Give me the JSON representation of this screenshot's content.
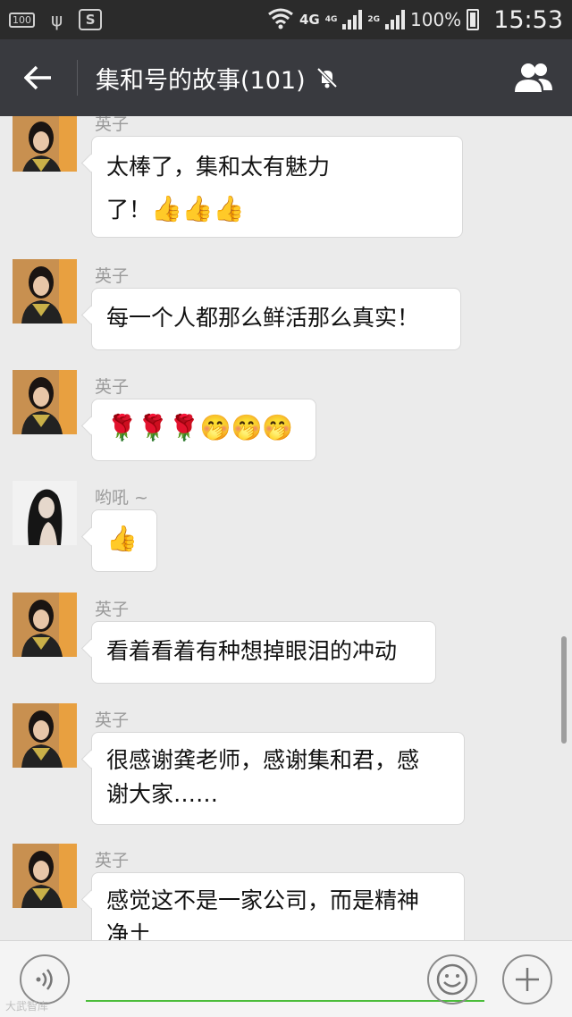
{
  "status_bar": {
    "notif_box": "100",
    "network": "4G",
    "sim1": "4G",
    "sim2": "2G",
    "battery": "100%",
    "time": "15:53"
  },
  "header": {
    "title": "集和号的故事(101)",
    "icons": {
      "back": "back-arrow-icon",
      "mute": "mute-bell-icon",
      "members": "group-members-icon"
    }
  },
  "messages": [
    {
      "sender": "英子",
      "text": [
        "太棒了，集和太有魅力",
        "了！"
      ],
      "emoji": "👍👍👍",
      "avatar": "avatar-yingzi"
    },
    {
      "sender": "英子",
      "text": [
        "每一个人都那么鲜活那么真实！"
      ],
      "avatar": "avatar-yingzi"
    },
    {
      "sender": "英子",
      "emoji": "🌹🌹🌹🤭🤭🤭",
      "avatar": "avatar-yingzi"
    },
    {
      "sender": "哟吼 ~",
      "emoji": "👍",
      "avatar": "avatar-youhou"
    },
    {
      "sender": "英子",
      "text": [
        "看着看着有种想掉眼泪的冲动"
      ],
      "avatar": "avatar-yingzi"
    },
    {
      "sender": "英子",
      "text": [
        "很感谢龚老师，感谢集和君，感",
        "谢大家……"
      ],
      "avatar": "avatar-yingzi"
    },
    {
      "sender": "英子",
      "text": [
        "感觉这不是一家公司，而是精神",
        "净土"
      ],
      "avatar": "avatar-yingzi"
    }
  ],
  "input_bar": {
    "icons": {
      "voice": "voice-icon",
      "emoji": "emoji-icon",
      "plus": "plus-icon"
    }
  },
  "watermark": "大武智库"
}
